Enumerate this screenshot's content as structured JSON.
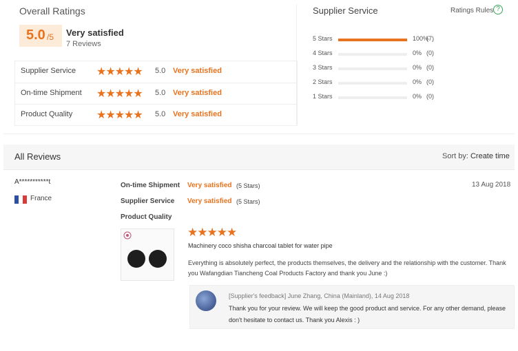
{
  "overall": {
    "title": "Overall Ratings",
    "score": "5.0",
    "score_max": "/5",
    "label": "Very satisfied",
    "reviews_count": "7 Reviews",
    "rows": [
      {
        "label": "Supplier Service",
        "stars": "★★★★★",
        "score": "5.0",
        "desc": "Very satisfied"
      },
      {
        "label": "On-time Shipment",
        "stars": "★★★★★",
        "score": "5.0",
        "desc": "Very satisfied"
      },
      {
        "label": "Product Quality",
        "stars": "★★★★★",
        "score": "5.0",
        "desc": "Very satisfied"
      }
    ]
  },
  "supplier_service": {
    "title": "Supplier Service",
    "rules_link": "Ratings Rules",
    "help_icon": "?",
    "distribution": [
      {
        "label": "5 Stars",
        "pct": "100%",
        "count": "(7)",
        "fill": 1.0
      },
      {
        "label": "4 Stars",
        "pct": "0%",
        "count": "(0)",
        "fill": 0
      },
      {
        "label": "3 Stars",
        "pct": "0%",
        "count": "(0)",
        "fill": 0
      },
      {
        "label": "2 Stars",
        "pct": "0%",
        "count": "(0)",
        "fill": 0
      },
      {
        "label": "1 Stars",
        "pct": "0%",
        "count": "(0)",
        "fill": 0
      }
    ]
  },
  "all_reviews": {
    "title": "All Reviews",
    "sort_label": "Sort by:",
    "sort_value": "Create time"
  },
  "review": {
    "reviewer": "A***********t",
    "country": "France",
    "date": "13 Aug 2018",
    "ratings": [
      {
        "label": "On-time Shipment",
        "value": "Very satisfied",
        "stars": "(5 Stars)"
      },
      {
        "label": "Supplier Service",
        "value": "Very satisfied",
        "stars": "(5 Stars)"
      },
      {
        "label": "Product Quality",
        "value": "",
        "stars": ""
      }
    ],
    "product_stars": "★★★★★",
    "product_name": "Machinery coco shisha charcoal tablet for water pipe",
    "text": "Everything is absolutely perfect, the products themselves, the delivery and the relationship with the customer. Thank you Wafangdian Tiancheng Coal Products Factory and thank you June :)",
    "feedback": {
      "header": "[Supplier's feedback] June Zhang, China (Mainland), 14 Aug 2018",
      "text": "Thank you for your review. We will keep the good product and service. For any other demand, please don't hesitate to contact us. Thank you Alexis : )"
    }
  },
  "colors": {
    "accent": "#e8731f",
    "rules_icon": "#3aa35a"
  }
}
